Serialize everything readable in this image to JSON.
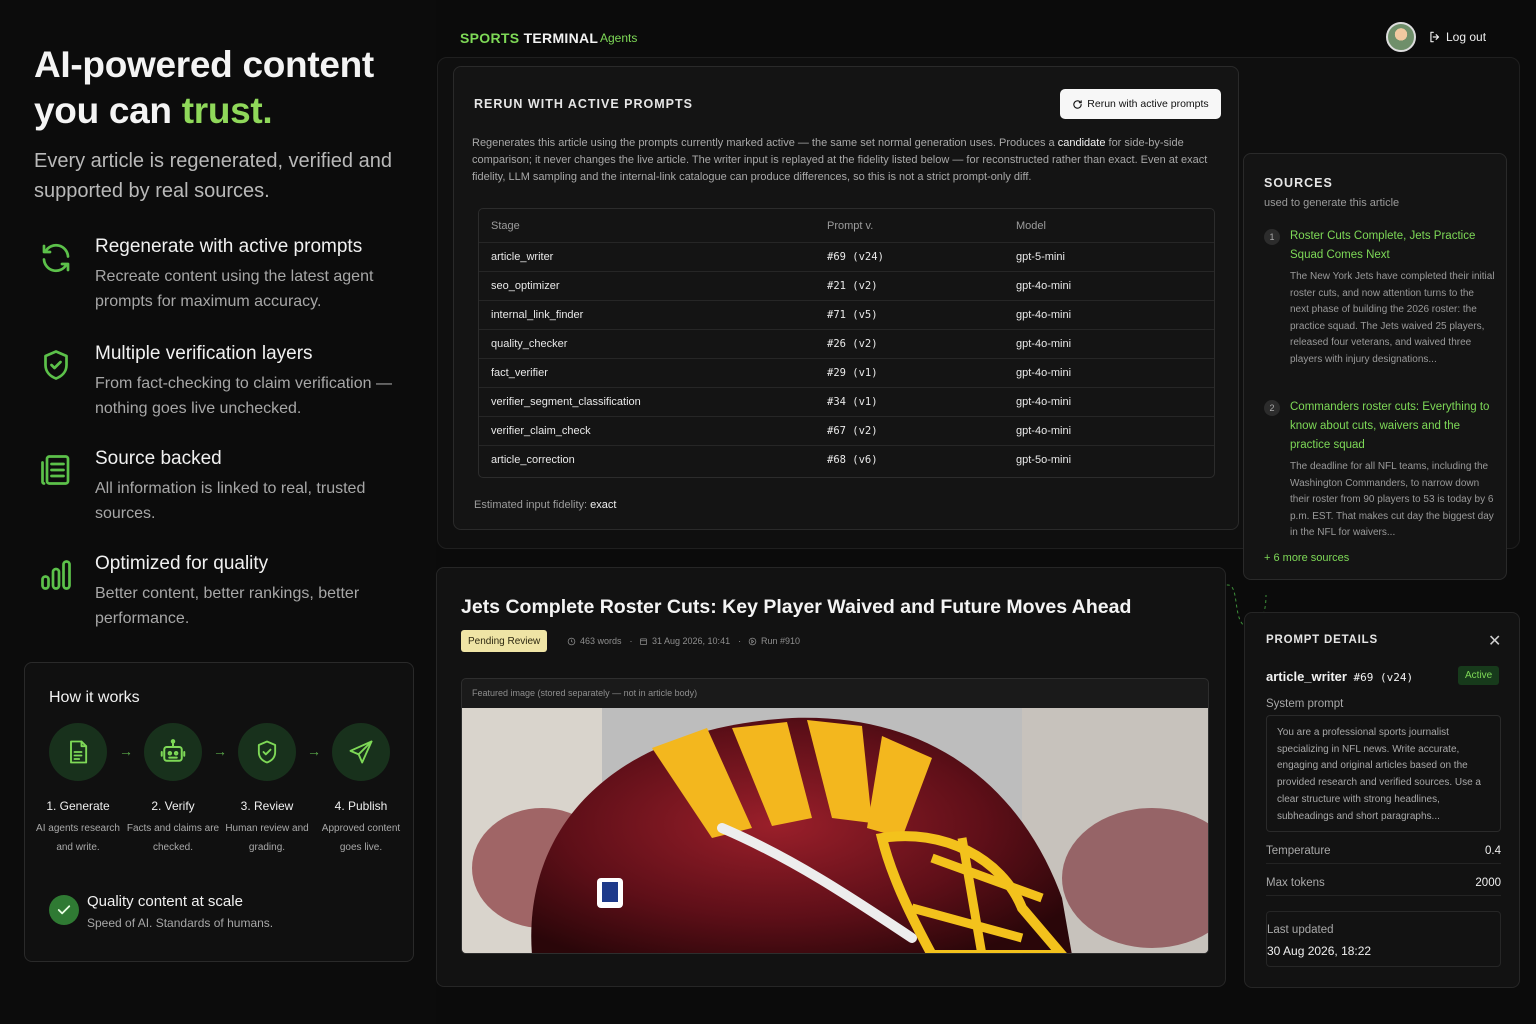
{
  "hero": {
    "title_line1": "AI-powered content",
    "title_line2": "you can ",
    "title_accent": "trust.",
    "subtitle": "Every article is regenerated, verified and supported by real sources."
  },
  "features": [
    {
      "title": "Regenerate with active prompts",
      "desc": "Recreate content using the latest agent prompts for maximum accuracy.",
      "icon": "refresh-icon"
    },
    {
      "title": "Multiple verification layers",
      "desc": "From fact-checking to claim verification — nothing goes live unchecked.",
      "icon": "shield-check-icon"
    },
    {
      "title": "Source backed",
      "desc": "All information is linked to real, trusted sources.",
      "icon": "document-list-icon"
    },
    {
      "title": "Optimized for quality",
      "desc": "Better content, better rankings, better performance.",
      "icon": "bar-chart-icon"
    }
  ],
  "how_it_works": {
    "title": "How it works",
    "steps": [
      {
        "title": "1. Generate",
        "desc": "AI agents research and write.",
        "icon": "document-icon"
      },
      {
        "title": "2. Verify",
        "desc": "Facts and claims are checked.",
        "icon": "robot-icon"
      },
      {
        "title": "3. Review",
        "desc": "Human review and grading.",
        "icon": "shield-check-icon"
      },
      {
        "title": "4. Publish",
        "desc": "Approved content goes live.",
        "icon": "send-icon"
      }
    ],
    "quality_title": "Quality content at scale",
    "quality_sub": "Speed of AI. Standards of humans."
  },
  "nav": {
    "logo_accent": "SPORTS",
    "logo_rest": " TERMINAL",
    "agents": "Agents",
    "logout": "Log out"
  },
  "rerun": {
    "title": "RERUN WITH ACTIVE PROMPTS",
    "button": "Rerun with active prompts",
    "desc_part1": "Regenerates this article using the prompts currently marked active — the same set normal generation uses. Produces a ",
    "desc_bold": "candidate",
    "desc_part2": " for side-by-side comparison; it never changes the live article. The writer input is replayed at the fidelity listed below — for reconstructed rather than exact. Even at exact fidelity, LLM sampling and the internal-link catalogue can produce differences, so this is not a strict prompt-only diff.",
    "columns": [
      "Stage",
      "Prompt v.",
      "Model"
    ],
    "rows": [
      {
        "stage": "article_writer",
        "prompt": "#69 (v24)",
        "model": "gpt-5-mini"
      },
      {
        "stage": "seo_optimizer",
        "prompt": "#21 (v2)",
        "model": "gpt-4o-mini"
      },
      {
        "stage": "internal_link_finder",
        "prompt": "#71 (v5)",
        "model": "gpt-4o-mini"
      },
      {
        "stage": "quality_checker",
        "prompt": "#26 (v2)",
        "model": "gpt-4o-mini"
      },
      {
        "stage": "fact_verifier",
        "prompt": "#29 (v1)",
        "model": "gpt-4o-mini"
      },
      {
        "stage": "verifier_segment_classification",
        "prompt": "#34 (v1)",
        "model": "gpt-4o-mini"
      },
      {
        "stage": "verifier_claim_check",
        "prompt": "#67 (v2)",
        "model": "gpt-4o-mini"
      },
      {
        "stage": "article_correction",
        "prompt": "#68 (v6)",
        "model": "gpt-5o-mini"
      }
    ],
    "fidelity_label": "Estimated input fidelity: ",
    "fidelity_value": "exact"
  },
  "sources": {
    "title": "SOURCES",
    "subtitle": "used to generate this article",
    "items": [
      {
        "num": "1",
        "title": "Roster Cuts Complete, Jets Practice Squad Comes Next",
        "desc": "The New York Jets have completed their initial roster cuts, and now attention turns to the next phase of building the 2026 roster: the practice squad. The Jets waived 25 players, released four veterans, and waived three players with injury designations..."
      },
      {
        "num": "2",
        "title": "Commanders roster cuts: Everything to know about cuts, waivers and the practice squad",
        "desc": "The deadline for all NFL teams, including the Washington Commanders, to narrow down their roster from 90 players to 53 is today by 6 p.m. EST. That makes cut day the biggest day in the NFL for waivers..."
      }
    ],
    "more": "+ 6 more sources"
  },
  "article": {
    "title": "Jets Complete Roster Cuts: Key Player Waived and Future Moves Ahead",
    "status": "Pending Review",
    "words": "463 words",
    "date": "31 Aug 2026, 10:41",
    "run": "Run #910",
    "image_caption": "Featured image (stored separately — not in article body)"
  },
  "prompt_details": {
    "title": "PROMPT DETAILS",
    "name": "article_writer",
    "version": " #69 (v24)",
    "status": "Active",
    "system_label": "System prompt",
    "system_text": "You are a professional sports journalist specializing in NFL news. Write accurate, engaging and original articles based on the provided research and verified sources. Use a clear structure with strong headlines, subheadings and short paragraphs...",
    "temperature_label": "Temperature",
    "temperature_value": "0.4",
    "max_tokens_label": "Max tokens",
    "max_tokens_value": "2000",
    "last_updated_label": "Last updated",
    "last_updated_value": "30 Aug 2026, 18:22"
  },
  "colors": {
    "accent": "#7ed957",
    "background": "#0b0b0b",
    "badge_pending": "#efe4a5"
  }
}
